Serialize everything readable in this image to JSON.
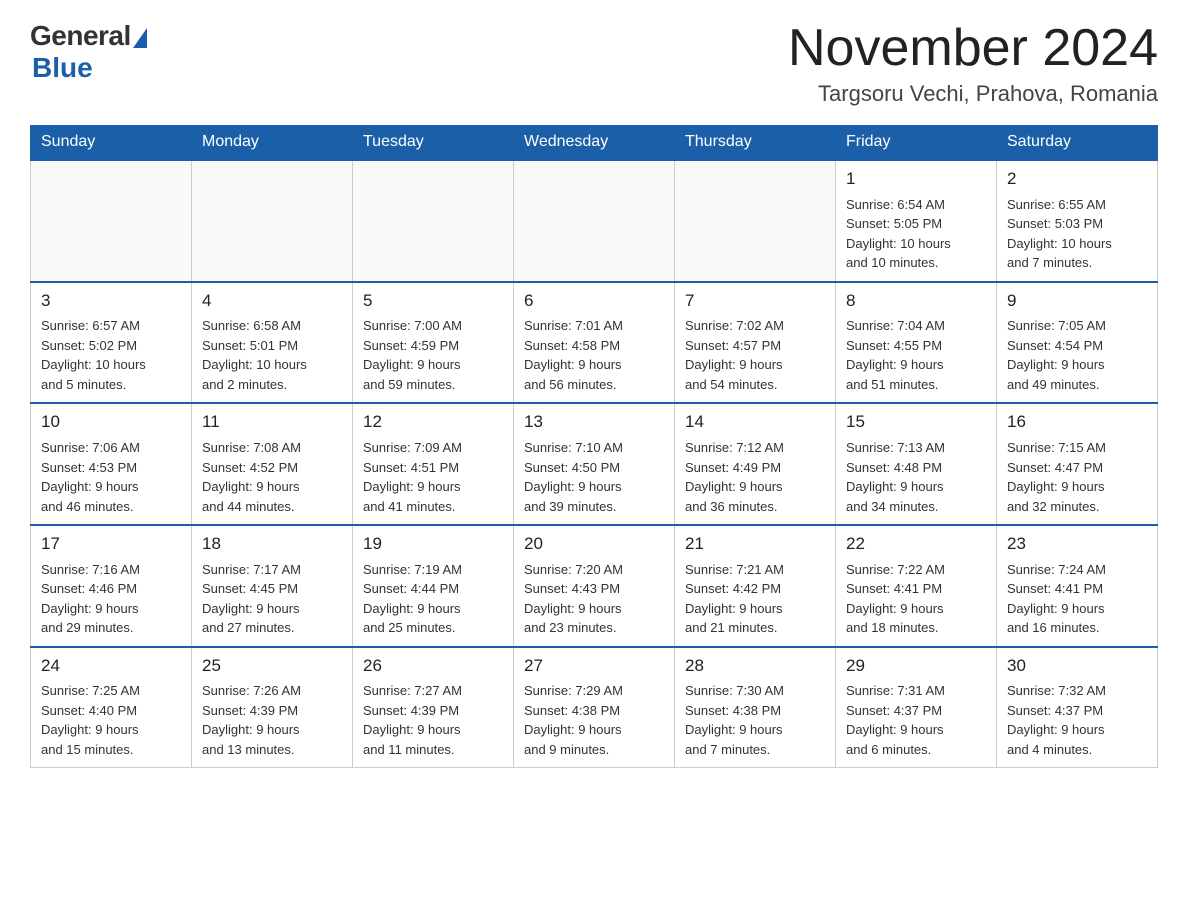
{
  "header": {
    "logo_general": "General",
    "logo_blue": "Blue",
    "month_title": "November 2024",
    "location": "Targsoru Vechi, Prahova, Romania"
  },
  "days_of_week": [
    "Sunday",
    "Monday",
    "Tuesday",
    "Wednesday",
    "Thursday",
    "Friday",
    "Saturday"
  ],
  "weeks": [
    [
      {
        "day": "",
        "info": ""
      },
      {
        "day": "",
        "info": ""
      },
      {
        "day": "",
        "info": ""
      },
      {
        "day": "",
        "info": ""
      },
      {
        "day": "",
        "info": ""
      },
      {
        "day": "1",
        "info": "Sunrise: 6:54 AM\nSunset: 5:05 PM\nDaylight: 10 hours\nand 10 minutes."
      },
      {
        "day": "2",
        "info": "Sunrise: 6:55 AM\nSunset: 5:03 PM\nDaylight: 10 hours\nand 7 minutes."
      }
    ],
    [
      {
        "day": "3",
        "info": "Sunrise: 6:57 AM\nSunset: 5:02 PM\nDaylight: 10 hours\nand 5 minutes."
      },
      {
        "day": "4",
        "info": "Sunrise: 6:58 AM\nSunset: 5:01 PM\nDaylight: 10 hours\nand 2 minutes."
      },
      {
        "day": "5",
        "info": "Sunrise: 7:00 AM\nSunset: 4:59 PM\nDaylight: 9 hours\nand 59 minutes."
      },
      {
        "day": "6",
        "info": "Sunrise: 7:01 AM\nSunset: 4:58 PM\nDaylight: 9 hours\nand 56 minutes."
      },
      {
        "day": "7",
        "info": "Sunrise: 7:02 AM\nSunset: 4:57 PM\nDaylight: 9 hours\nand 54 minutes."
      },
      {
        "day": "8",
        "info": "Sunrise: 7:04 AM\nSunset: 4:55 PM\nDaylight: 9 hours\nand 51 minutes."
      },
      {
        "day": "9",
        "info": "Sunrise: 7:05 AM\nSunset: 4:54 PM\nDaylight: 9 hours\nand 49 minutes."
      }
    ],
    [
      {
        "day": "10",
        "info": "Sunrise: 7:06 AM\nSunset: 4:53 PM\nDaylight: 9 hours\nand 46 minutes."
      },
      {
        "day": "11",
        "info": "Sunrise: 7:08 AM\nSunset: 4:52 PM\nDaylight: 9 hours\nand 44 minutes."
      },
      {
        "day": "12",
        "info": "Sunrise: 7:09 AM\nSunset: 4:51 PM\nDaylight: 9 hours\nand 41 minutes."
      },
      {
        "day": "13",
        "info": "Sunrise: 7:10 AM\nSunset: 4:50 PM\nDaylight: 9 hours\nand 39 minutes."
      },
      {
        "day": "14",
        "info": "Sunrise: 7:12 AM\nSunset: 4:49 PM\nDaylight: 9 hours\nand 36 minutes."
      },
      {
        "day": "15",
        "info": "Sunrise: 7:13 AM\nSunset: 4:48 PM\nDaylight: 9 hours\nand 34 minutes."
      },
      {
        "day": "16",
        "info": "Sunrise: 7:15 AM\nSunset: 4:47 PM\nDaylight: 9 hours\nand 32 minutes."
      }
    ],
    [
      {
        "day": "17",
        "info": "Sunrise: 7:16 AM\nSunset: 4:46 PM\nDaylight: 9 hours\nand 29 minutes."
      },
      {
        "day": "18",
        "info": "Sunrise: 7:17 AM\nSunset: 4:45 PM\nDaylight: 9 hours\nand 27 minutes."
      },
      {
        "day": "19",
        "info": "Sunrise: 7:19 AM\nSunset: 4:44 PM\nDaylight: 9 hours\nand 25 minutes."
      },
      {
        "day": "20",
        "info": "Sunrise: 7:20 AM\nSunset: 4:43 PM\nDaylight: 9 hours\nand 23 minutes."
      },
      {
        "day": "21",
        "info": "Sunrise: 7:21 AM\nSunset: 4:42 PM\nDaylight: 9 hours\nand 21 minutes."
      },
      {
        "day": "22",
        "info": "Sunrise: 7:22 AM\nSunset: 4:41 PM\nDaylight: 9 hours\nand 18 minutes."
      },
      {
        "day": "23",
        "info": "Sunrise: 7:24 AM\nSunset: 4:41 PM\nDaylight: 9 hours\nand 16 minutes."
      }
    ],
    [
      {
        "day": "24",
        "info": "Sunrise: 7:25 AM\nSunset: 4:40 PM\nDaylight: 9 hours\nand 15 minutes."
      },
      {
        "day": "25",
        "info": "Sunrise: 7:26 AM\nSunset: 4:39 PM\nDaylight: 9 hours\nand 13 minutes."
      },
      {
        "day": "26",
        "info": "Sunrise: 7:27 AM\nSunset: 4:39 PM\nDaylight: 9 hours\nand 11 minutes."
      },
      {
        "day": "27",
        "info": "Sunrise: 7:29 AM\nSunset: 4:38 PM\nDaylight: 9 hours\nand 9 minutes."
      },
      {
        "day": "28",
        "info": "Sunrise: 7:30 AM\nSunset: 4:38 PM\nDaylight: 9 hours\nand 7 minutes."
      },
      {
        "day": "29",
        "info": "Sunrise: 7:31 AM\nSunset: 4:37 PM\nDaylight: 9 hours\nand 6 minutes."
      },
      {
        "day": "30",
        "info": "Sunrise: 7:32 AM\nSunset: 4:37 PM\nDaylight: 9 hours\nand 4 minutes."
      }
    ]
  ]
}
